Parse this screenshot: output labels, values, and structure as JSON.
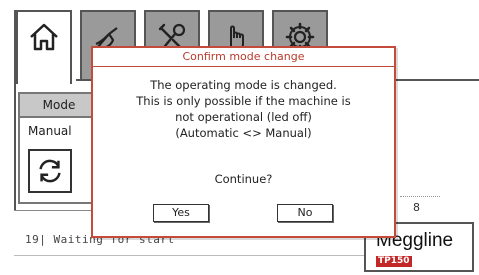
{
  "tabs": [
    {
      "name": "home",
      "icon": "home-icon",
      "active": true
    },
    {
      "name": "tab-2",
      "icon": "hand-pointer-icon",
      "active": false
    },
    {
      "name": "tab-3",
      "icon": "tools-icon",
      "active": false
    },
    {
      "name": "tab-4",
      "icon": "touch-hand-icon",
      "active": false
    },
    {
      "name": "settings",
      "icon": "gear-icon",
      "active": false
    }
  ],
  "mode_panel": {
    "header": "Mode",
    "value": "Manual",
    "toggle_icon": "refresh-icon"
  },
  "status": {
    "text": "19| Waiting for start",
    "digit": "8"
  },
  "logo": {
    "name": "Meggline",
    "sub": "TP150"
  },
  "dialog": {
    "title": "Confirm mode change",
    "line1": "The operating mode is changed.",
    "line2": "This is only possible if the machine is",
    "line3": "not operational (led off)",
    "line4": "(Automatic <> Manual)",
    "question": "Continue?",
    "yes_label": "Yes",
    "no_label": "No"
  },
  "colors": {
    "dialog_border": "#c44a3a",
    "dialog_title": "#b83a2a",
    "inactive_tab": "#9a9a9a",
    "logo_sub_bg": "#c22828"
  }
}
